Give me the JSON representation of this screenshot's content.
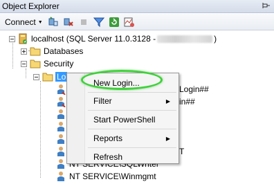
{
  "panel": {
    "title": "Object Explorer"
  },
  "toolbar": {
    "connect_label": "Connect"
  },
  "tree": {
    "server_label": "localhost (SQL Server 11.0.3128 - ",
    "server_suffix": ")",
    "databases_label": "Databases",
    "security_label": "Security",
    "logins_label": "Lo",
    "logins": [
      {
        "label": "",
        "suffix": "Login##"
      },
      {
        "label": "",
        "suffix": "in##"
      },
      {
        "label": "",
        "suffix": ""
      },
      {
        "label": "",
        "suffix": ""
      },
      {
        "label": "",
        "suffix": ""
      },
      {
        "label": "",
        "suffix": "T"
      },
      {
        "label": "NT SERVICE\\SQLWriter",
        "suffix": ""
      },
      {
        "label": "NT SERVICE\\Winmgmt",
        "suffix": ""
      }
    ]
  },
  "context_menu": {
    "new_login": "New Login...",
    "filter": "Filter",
    "start_powershell": "Start PowerShell",
    "reports": "Reports",
    "refresh": "Refresh"
  },
  "colors": {
    "selection": "#3399ff",
    "highlight_ring": "#3fd13a"
  }
}
